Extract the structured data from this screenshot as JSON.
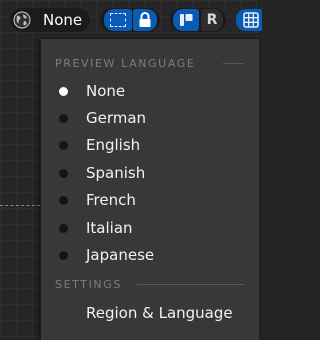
{
  "toolbar": {
    "language_button": {
      "icon": "globe-icon",
      "label": "None"
    },
    "selection_tool": {
      "icon": "marquee-select-icon",
      "active": true
    },
    "lock_tool": {
      "icon": "lock-icon",
      "active": true
    },
    "snap_tool": {
      "icon": "snap-icon",
      "active": true
    },
    "r_tool": {
      "label": "R"
    },
    "grid_tool": {
      "icon": "grid-icon",
      "active": true
    },
    "colors": {
      "accent": "#0a5bb4",
      "pill_bg": "#1b1b1b"
    }
  },
  "menu": {
    "preview_header": "PREVIEW LANGUAGE",
    "languages": [
      {
        "label": "None",
        "selected": true
      },
      {
        "label": "German",
        "selected": false
      },
      {
        "label": "English",
        "selected": false
      },
      {
        "label": "Spanish",
        "selected": false
      },
      {
        "label": "French",
        "selected": false
      },
      {
        "label": "Italian",
        "selected": false
      },
      {
        "label": "Japanese",
        "selected": false
      }
    ],
    "settings_header": "SETTINGS",
    "settings_items": [
      {
        "label": "Region & Language"
      }
    ]
  }
}
